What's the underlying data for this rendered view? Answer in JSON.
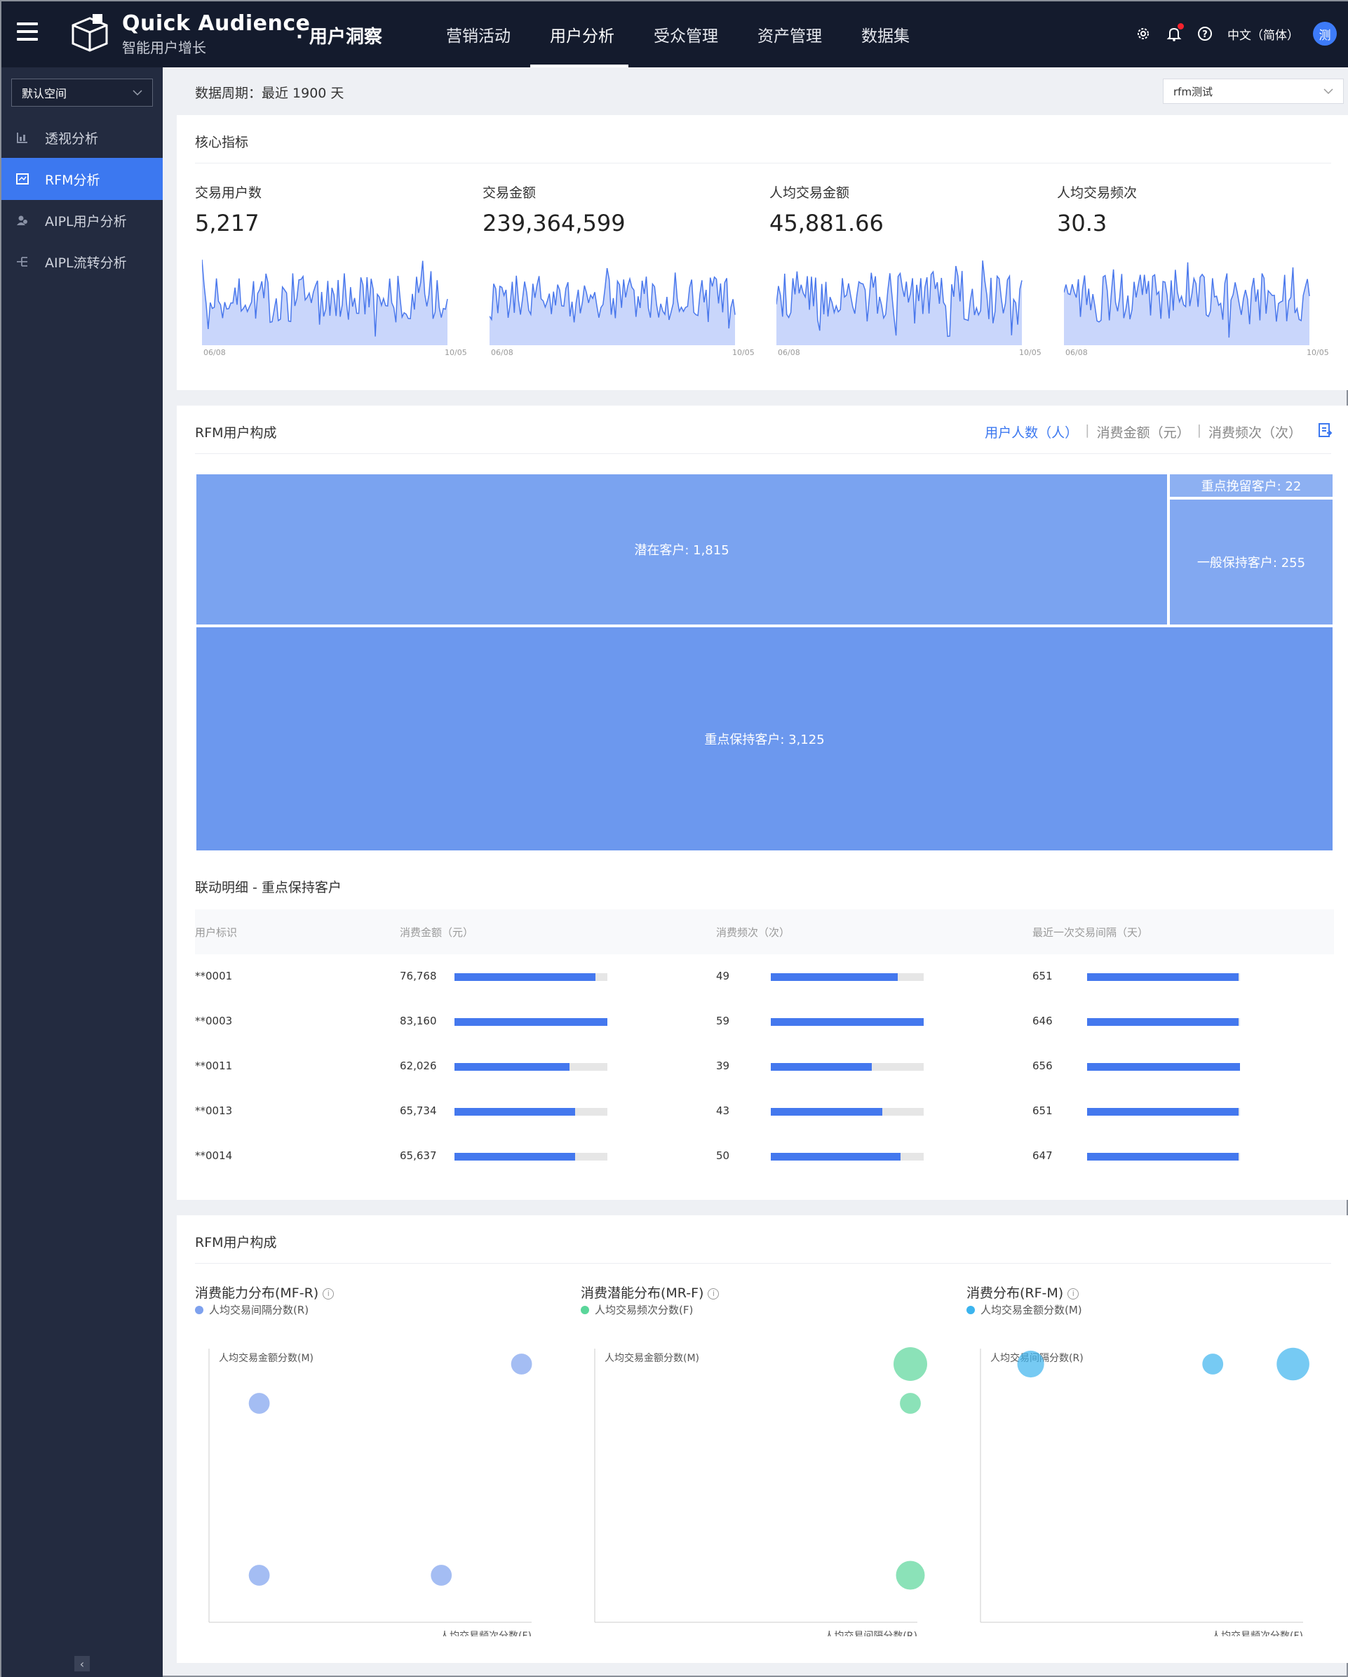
{
  "topbar": {
    "brand_name": "Quick Audience",
    "brand_sub": "智能用户增长",
    "product_name": "· 用户洞察",
    "nav": [
      {
        "label": "营销活动",
        "active": false
      },
      {
        "label": "用户分析",
        "active": true
      },
      {
        "label": "受众管理",
        "active": false
      },
      {
        "label": "资产管理",
        "active": false
      },
      {
        "label": "数据集",
        "active": false
      }
    ],
    "icons": [
      "gear-icon",
      "bell-icon",
      "help-icon"
    ],
    "language": "中文（简体）",
    "avatar_text": "测"
  },
  "sidebar": {
    "space_label": "默认空间",
    "items": [
      {
        "label": "透视分析",
        "icon": "chart-icon",
        "active": false
      },
      {
        "label": "RFM分析",
        "icon": "rfm-icon",
        "active": true
      },
      {
        "label": "AIPL用户分析",
        "icon": "users-icon",
        "active": false
      },
      {
        "label": "AIPL流转分析",
        "icon": "flow-icon",
        "active": false
      }
    ]
  },
  "period": {
    "label": "数据周期：最近 1900 天",
    "selected_rfm": "rfm测试"
  },
  "core_metrics": {
    "title": "核心指标",
    "metrics": [
      {
        "label": "交易用户数",
        "value": "5,217",
        "date_start": "06/08",
        "date_end": "10/05"
      },
      {
        "label": "交易金额",
        "value": "239,364,599",
        "date_start": "06/08",
        "date_end": "10/05"
      },
      {
        "label": "人均交易金额",
        "value": "45,881.66",
        "date_start": "06/08",
        "date_end": "10/05"
      },
      {
        "label": "人均交易频次",
        "value": "30.3",
        "date_start": "06/08",
        "date_end": "10/05"
      }
    ],
    "accent_color": "#4a78ec",
    "fill_color": "#c9d6fb"
  },
  "rfm_composition": {
    "title": "RFM用户构成",
    "modes": [
      {
        "label": "用户人数（人）",
        "active": true
      },
      {
        "label": "消费金额（元）",
        "active": false
      },
      {
        "label": "消费频次（次）",
        "active": false
      }
    ],
    "segments": [
      {
        "name": "潜在客户",
        "value": 1815,
        "label": "潜在客户: 1,815",
        "color": "#7aa3f0"
      },
      {
        "name": "重点挽留客户",
        "value": 22,
        "label": "重点挽留客户: 22",
        "color": "#8db0f2"
      },
      {
        "name": "一般保持客户",
        "value": 255,
        "label": "一般保持客户: 255",
        "color": "#82a8f1"
      },
      {
        "name": "重点保持客户",
        "value": 3125,
        "label": "重点保持客户: 3,125",
        "color": "#6c98ee"
      }
    ],
    "detail_title": "联动明细 - 重点保持客户",
    "columns": [
      "用户标识",
      "消费金额（元）",
      "消费频次（次）",
      "最近一次交易间隔（天）"
    ],
    "rows": [
      {
        "id": "**0001",
        "amount": "76,768",
        "amount_frac": 0.92,
        "freq": "49",
        "freq_frac": 0.83,
        "recency": "651",
        "recency_frac": 0.99
      },
      {
        "id": "**0003",
        "amount": "83,160",
        "amount_frac": 1.0,
        "freq": "59",
        "freq_frac": 1.0,
        "recency": "646",
        "recency_frac": 0.99
      },
      {
        "id": "**0011",
        "amount": "62,026",
        "amount_frac": 0.75,
        "freq": "39",
        "freq_frac": 0.66,
        "recency": "656",
        "recency_frac": 1.0
      },
      {
        "id": "**0013",
        "amount": "65,734",
        "amount_frac": 0.79,
        "freq": "43",
        "freq_frac": 0.73,
        "recency": "651",
        "recency_frac": 0.99
      },
      {
        "id": "**0014",
        "amount": "65,637",
        "amount_frac": 0.79,
        "freq": "50",
        "freq_frac": 0.85,
        "recency": "647",
        "recency_frac": 0.99
      }
    ]
  },
  "rfm_bubbles": {
    "title": "RFM用户构成",
    "charts": [
      {
        "title": "消费能力分布(MF-R)",
        "legend": "人均交易间隔分数(R)",
        "ylabel": "人均交易金额分数(M)",
        "xlabel": "人均交易频次分数(F)",
        "color": "#7ea1ee",
        "points": [
          {
            "x": 0.14,
            "y": 0.84,
            "r": 0.35
          },
          {
            "x": 0.99,
            "y": 1.0,
            "r": 0.35
          },
          {
            "x": 0.14,
            "y": 0.14,
            "r": 0.35
          },
          {
            "x": 0.73,
            "y": 0.14,
            "r": 0.35
          }
        ]
      },
      {
        "title": "消费潜能分布(MR-F)",
        "legend": "人均交易频次分数(F)",
        "ylabel": "人均交易金额分数(M)",
        "xlabel": "人均交易间隔分数(R)",
        "color": "#5ad69a",
        "points": [
          {
            "x": 1.0,
            "y": 1.0,
            "r": 1.0
          },
          {
            "x": 1.0,
            "y": 0.84,
            "r": 0.35
          },
          {
            "x": 1.0,
            "y": 0.14,
            "r": 0.75
          }
        ]
      },
      {
        "title": "消费分布(RF-M)",
        "legend": "人均交易金额分数(M)",
        "ylabel": "人均交易间隔分数(R)",
        "xlabel": "人均交易频次分数(F)",
        "color": "#3cb4ee",
        "points": [
          {
            "x": 0.14,
            "y": 1.0,
            "r": 0.65
          },
          {
            "x": 0.73,
            "y": 1.0,
            "r": 0.35
          },
          {
            "x": 0.99,
            "y": 1.0,
            "r": 0.95
          }
        ]
      }
    ]
  }
}
